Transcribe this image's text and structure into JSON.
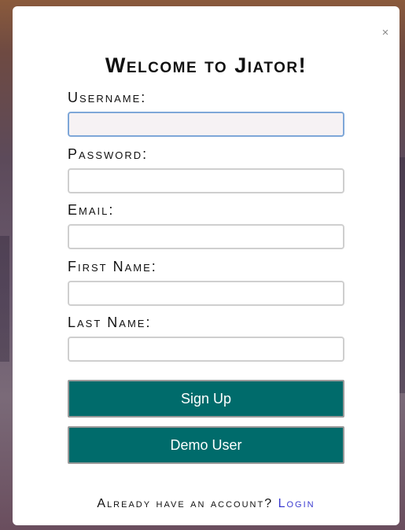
{
  "modal": {
    "close_label": "×",
    "title": "Welcome to Jiator!",
    "fields": [
      {
        "label": "Username:",
        "value": ""
      },
      {
        "label": "Password:",
        "value": ""
      },
      {
        "label": "Email:",
        "value": ""
      },
      {
        "label": "First Name:",
        "value": ""
      },
      {
        "label": "Last Name:",
        "value": ""
      }
    ],
    "signup_label": "Sign Up",
    "demo_label": "Demo User",
    "footer_text": "Already have an account?",
    "login_label": "Login"
  },
  "colors": {
    "button_bg": "#006b6b",
    "focus_border": "#7ea7d8",
    "link": "#3a3ad0"
  }
}
